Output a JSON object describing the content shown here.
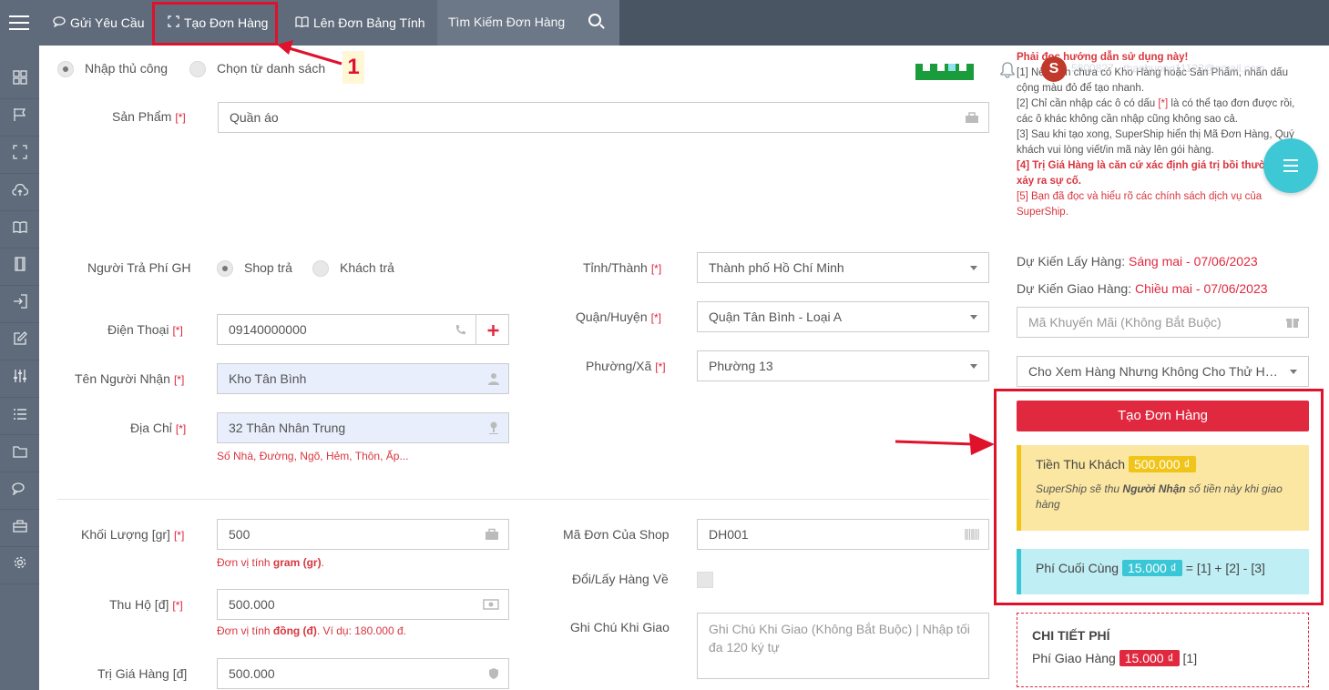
{
  "topbar": {
    "nav_request": "Gửi Yêu Cầu",
    "nav_create": "Tạo Đơn Hàng",
    "nav_sheet": "Lên Đơn Bảng Tính",
    "search_placeholder": "Tìm Kiếm Đơn Hàng",
    "user_email": "5800827 - thaohuong11123@gmail.com",
    "avatar_letter": "S"
  },
  "annotation": {
    "step_number": "1"
  },
  "mode": {
    "manual": "Nhập thủ công",
    "from_list": "Chọn từ danh sách"
  },
  "form": {
    "product_label": "Sản Phẩm",
    "product_value": "Quần áo",
    "payer_label": "Người Trả Phí GH",
    "payer_shop": "Shop trả",
    "payer_customer": "Khách trả",
    "phone_label": "Điện Thoại",
    "phone_value": "09140000000",
    "recipient_label": "Tên Người Nhận",
    "recipient_value": "Kho Tân Bình",
    "address_label": "Địa Chỉ",
    "address_value": "32 Thân Nhân Trung",
    "address_hint": "Số Nhà, Đường, Ngõ, Hẻm, Thôn, Ấp...",
    "province_label": "Tỉnh/Thành",
    "province_value": "Thành phố Hồ Chí Minh",
    "district_label": "Quận/Huyện",
    "district_value": "Quận Tân Bình - Loại A",
    "ward_label": "Phường/Xã",
    "ward_value": "Phường 13",
    "weight_label": "Khối Lượng [gr]",
    "weight_value": "500",
    "weight_hint_pre": "Đơn vị tính ",
    "weight_hint_bold": "gram (gr)",
    "weight_hint_post": ".",
    "cod_label": "Thu Hộ [đ]",
    "cod_value": "500.000",
    "cod_hint_pre": "Đơn vị tính ",
    "cod_hint_bold": "đồng (đ)",
    "cod_hint_post": ". Ví dụ: 180.000 đ.",
    "value_label": "Trị Giá Hàng [đ]",
    "value_value": "500.000",
    "shop_code_label": "Mã Đơn Của Shop",
    "shop_code_value": "DH001",
    "exchange_label": "Đổi/Lấy Hàng Về",
    "note_label": "Ghi Chú Khi Giao",
    "note_placeholder": "Ghi Chú Khi Giao (Không Bắt Buộc) | Nhập tối đa 120 ký tự",
    "required_mark": "[*]"
  },
  "guide": {
    "title": "Phải đọc hướng dẫn sử dụng này!",
    "l1": "[1] Nếu bạn chưa có Kho Hàng hoặc Sản Phẩm, nhấn dấu cộng màu đỏ để tạo nhanh.",
    "l2a": "[2] Chỉ cần nhập các ô có dấu ",
    "l2b": "[*]",
    "l2c": " là có thể tạo đơn được rồi, các ô khác không cần nhập cũng không sao cả.",
    "l3": "[3] Sau khi tạo xong, SuperShip hiển thị Mã Đơn Hàng, Quý khách vui lòng viết/in mã này lên gói hàng.",
    "l4": "[4] Trị Giá Hàng là căn cứ xác định giá trị bồi thường khi xảy ra sự cố.",
    "l5": "[5] Bạn đã đọc và hiểu rõ các chính sách dịch vụ của SuperShip."
  },
  "schedule": {
    "pickup_label": "Dự Kiến Lấy Hàng:",
    "pickup_value": "Sáng mai - 07/06/2023",
    "delivery_label": "Dự Kiến Giao Hàng:",
    "delivery_value": "Chiều mai - 07/06/2023"
  },
  "promo_placeholder": "Mã Khuyến Mãi (Không Bắt Buộc)",
  "view_option": "Cho Xem Hàng Nhưng Không Cho Thử Hàng",
  "create_button": "Tạo Đơn Hàng",
  "collect": {
    "label": "Tiền Thu Khách",
    "amount": "500.000 ₫",
    "note_pre": "SuperShip sẽ thu ",
    "note_bold": "Người Nhận",
    "note_post": " số tiền này khi giao hàng"
  },
  "final_fee": {
    "label": "Phí Cuối Cùng",
    "amount": "15.000 ₫",
    "formula": "= [1] + [2] - [3]"
  },
  "fee_detail": {
    "title": "CHI TIẾT PHÍ",
    "delivery_label": "Phí Giao Hàng",
    "delivery_amount": "15.000 ₫",
    "ref": "[1]"
  },
  "colors": {
    "accent_red": "#e0283f",
    "topbar": "#5f6b7a",
    "teal": "#3ec8d6",
    "yellow": "#f0c419"
  },
  "icons": [
    "menu-icon",
    "chat-icon",
    "scan-icon",
    "book-icon",
    "search-icon",
    "bell-icon",
    "dashboard-icon",
    "flag-icon",
    "cloud-upload-icon",
    "film-icon",
    "login-icon",
    "edit-icon",
    "sliders-icon",
    "list-icon",
    "folder-icon",
    "comments-icon",
    "briefcase-icon",
    "gear-icon"
  ]
}
